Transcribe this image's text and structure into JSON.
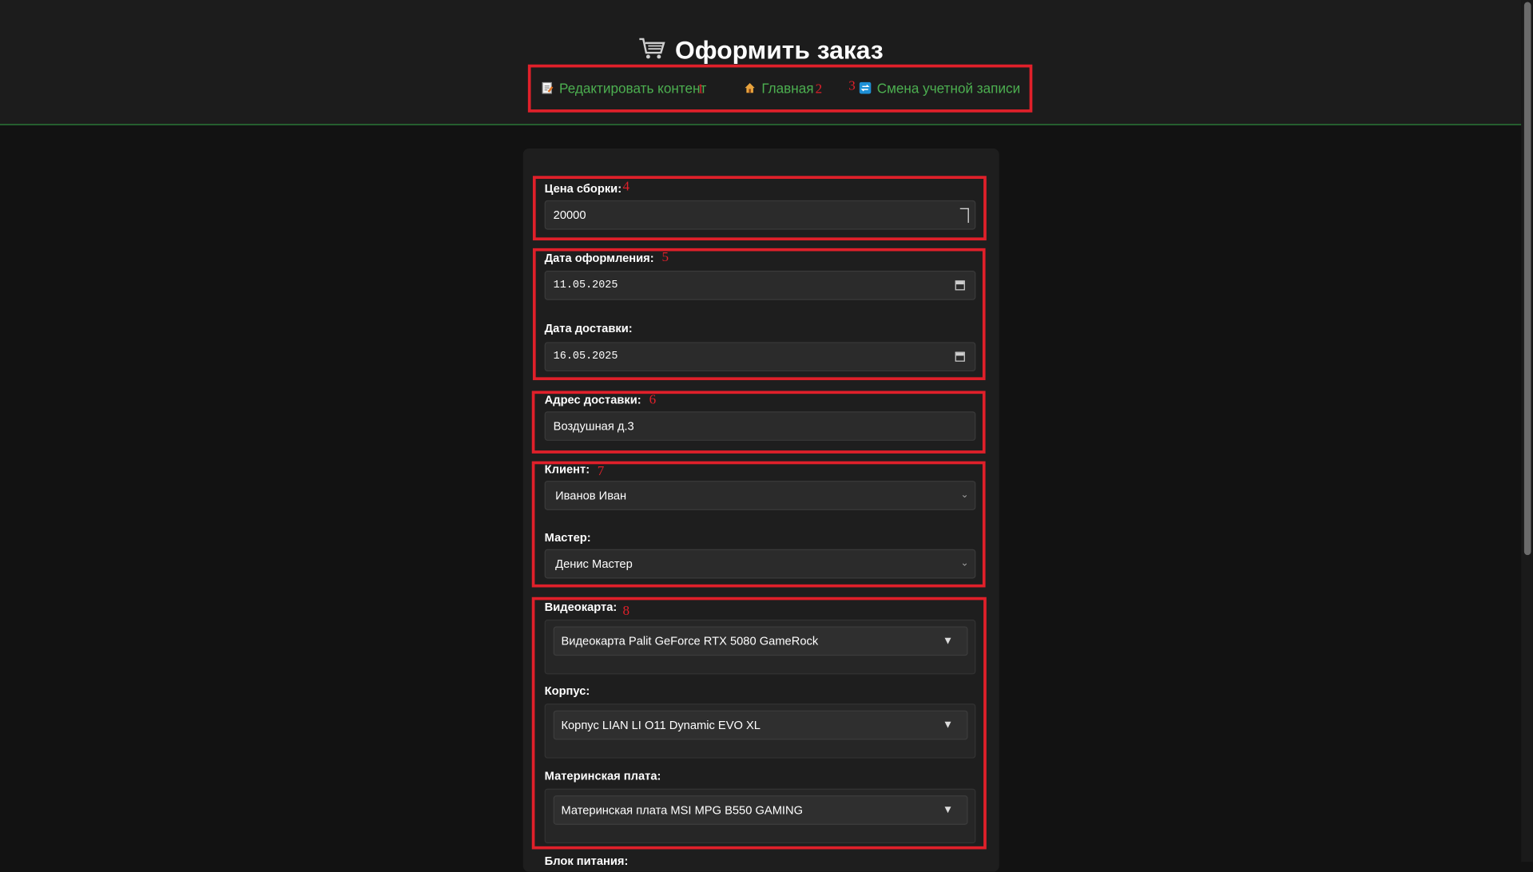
{
  "page": {
    "title": "Оформить заказ",
    "title_icon": "shopping-cart-icon"
  },
  "nav": {
    "items": [
      {
        "label": "Редактировать контент",
        "icon": "memo-icon"
      },
      {
        "label": "Главная",
        "icon": "house-icon"
      },
      {
        "label": "Смена учетной записи",
        "icon": "switch-account-icon"
      }
    ]
  },
  "annotations": [
    "1",
    "2",
    "3",
    "4",
    "5",
    "6",
    "7",
    "8"
  ],
  "form": {
    "price_label": "Цена сборки:",
    "price_value": "20000",
    "order_date_label": "Дата оформления:",
    "order_date_value": "11.05.2025",
    "delivery_date_label": "Дата доставки:",
    "delivery_date_value": "16.05.2025",
    "address_label": "Адрес доставки:",
    "address_value": "Воздушная д.3",
    "client_label": "Клиент:",
    "client_value": "Иванов Иван",
    "master_label": "Мастер:",
    "master_value": "Денис Мастер",
    "gpu_label": "Видеокарта:",
    "gpu_value": "Видеокарта Palit GeForce RTX 5080 GameRock",
    "case_label": "Корпус:",
    "case_value": "Корпус LIAN LI O11 Dynamic EVO XL",
    "mobo_label": "Материнская плата:",
    "mobo_value": "Материнская плата MSI MPG B550 GAMING",
    "psu_label": "Блок питания:"
  },
  "colors": {
    "accent": "#4caf50",
    "annotation": "#e0202a",
    "background": "#121212"
  }
}
